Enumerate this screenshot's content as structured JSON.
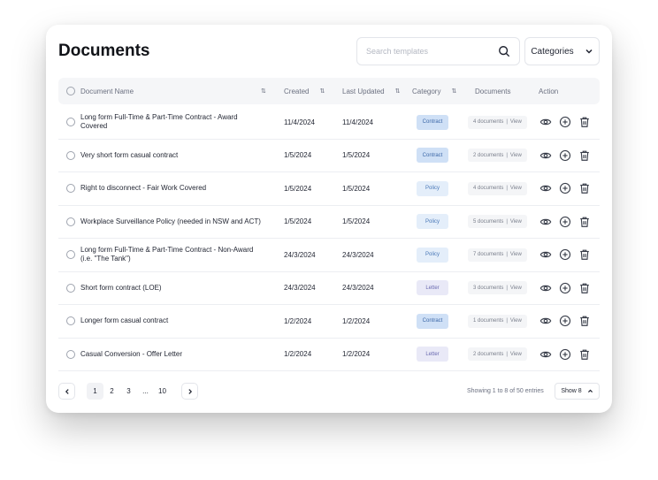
{
  "header": {
    "title": "Documents",
    "search_placeholder": "Search templates",
    "categories_label": "Categories"
  },
  "columns": {
    "name": "Document Name",
    "created": "Created",
    "updated": "Last Updated",
    "category": "Category",
    "documents": "Documents",
    "action": "Action"
  },
  "category_colors": {
    "Contract": {
      "bg": "#cfe0f6",
      "fg": "#3d68a8"
    },
    "Policy": {
      "bg": "#e4eefa",
      "fg": "#4a78b8"
    },
    "Letter": {
      "bg": "#e9e9f7",
      "fg": "#6a6ab0"
    }
  },
  "rows": [
    {
      "name": "Long form Full-Time & Part-Time Contract - Award Covered",
      "created": "11/4/2024",
      "updated": "11/4/2024",
      "category": "Contract",
      "documents": "4 documents",
      "view": "View"
    },
    {
      "name": "Very short form casual contract",
      "created": "1/5/2024",
      "updated": "1/5/2024",
      "category": "Contract",
      "documents": "2 documents",
      "view": "View"
    },
    {
      "name": "Right to disconnect - Fair Work Covered",
      "created": "1/5/2024",
      "updated": "1/5/2024",
      "category": "Policy",
      "documents": "4 documents",
      "view": "View"
    },
    {
      "name": "Workplace Surveillance Policy (needed in NSW and ACT)",
      "created": "1/5/2024",
      "updated": "1/5/2024",
      "category": "Policy",
      "documents": "5 documents",
      "view": "View"
    },
    {
      "name": "Long form Full-Time  & Part-Time Contract - Non-Award (i.e. \"The Tank\")",
      "created": "24/3/2024",
      "updated": "24/3/2024",
      "category": "Policy",
      "documents": "7 documents",
      "view": "View"
    },
    {
      "name": "Short form contract (LOE)",
      "created": "24/3/2024",
      "updated": "24/3/2024",
      "category": "Letter",
      "documents": "3 documents",
      "view": "View"
    },
    {
      "name": "Longer form casual contract",
      "created": "1/2/2024",
      "updated": "1/2/2024",
      "category": "Contract",
      "documents": "1 documents",
      "view": "View"
    },
    {
      "name": "Casual Conversion -  Offer Letter",
      "created": "1/2/2024",
      "updated": "1/2/2024",
      "category": "Letter",
      "documents": "2 documents",
      "view": "View"
    }
  ],
  "pagination": {
    "pages": [
      "1",
      "2",
      "3",
      "...",
      "10"
    ],
    "active_page": "1",
    "showing": "Showing 1 to 8 of 50 entries",
    "show_label": "Show 8"
  }
}
